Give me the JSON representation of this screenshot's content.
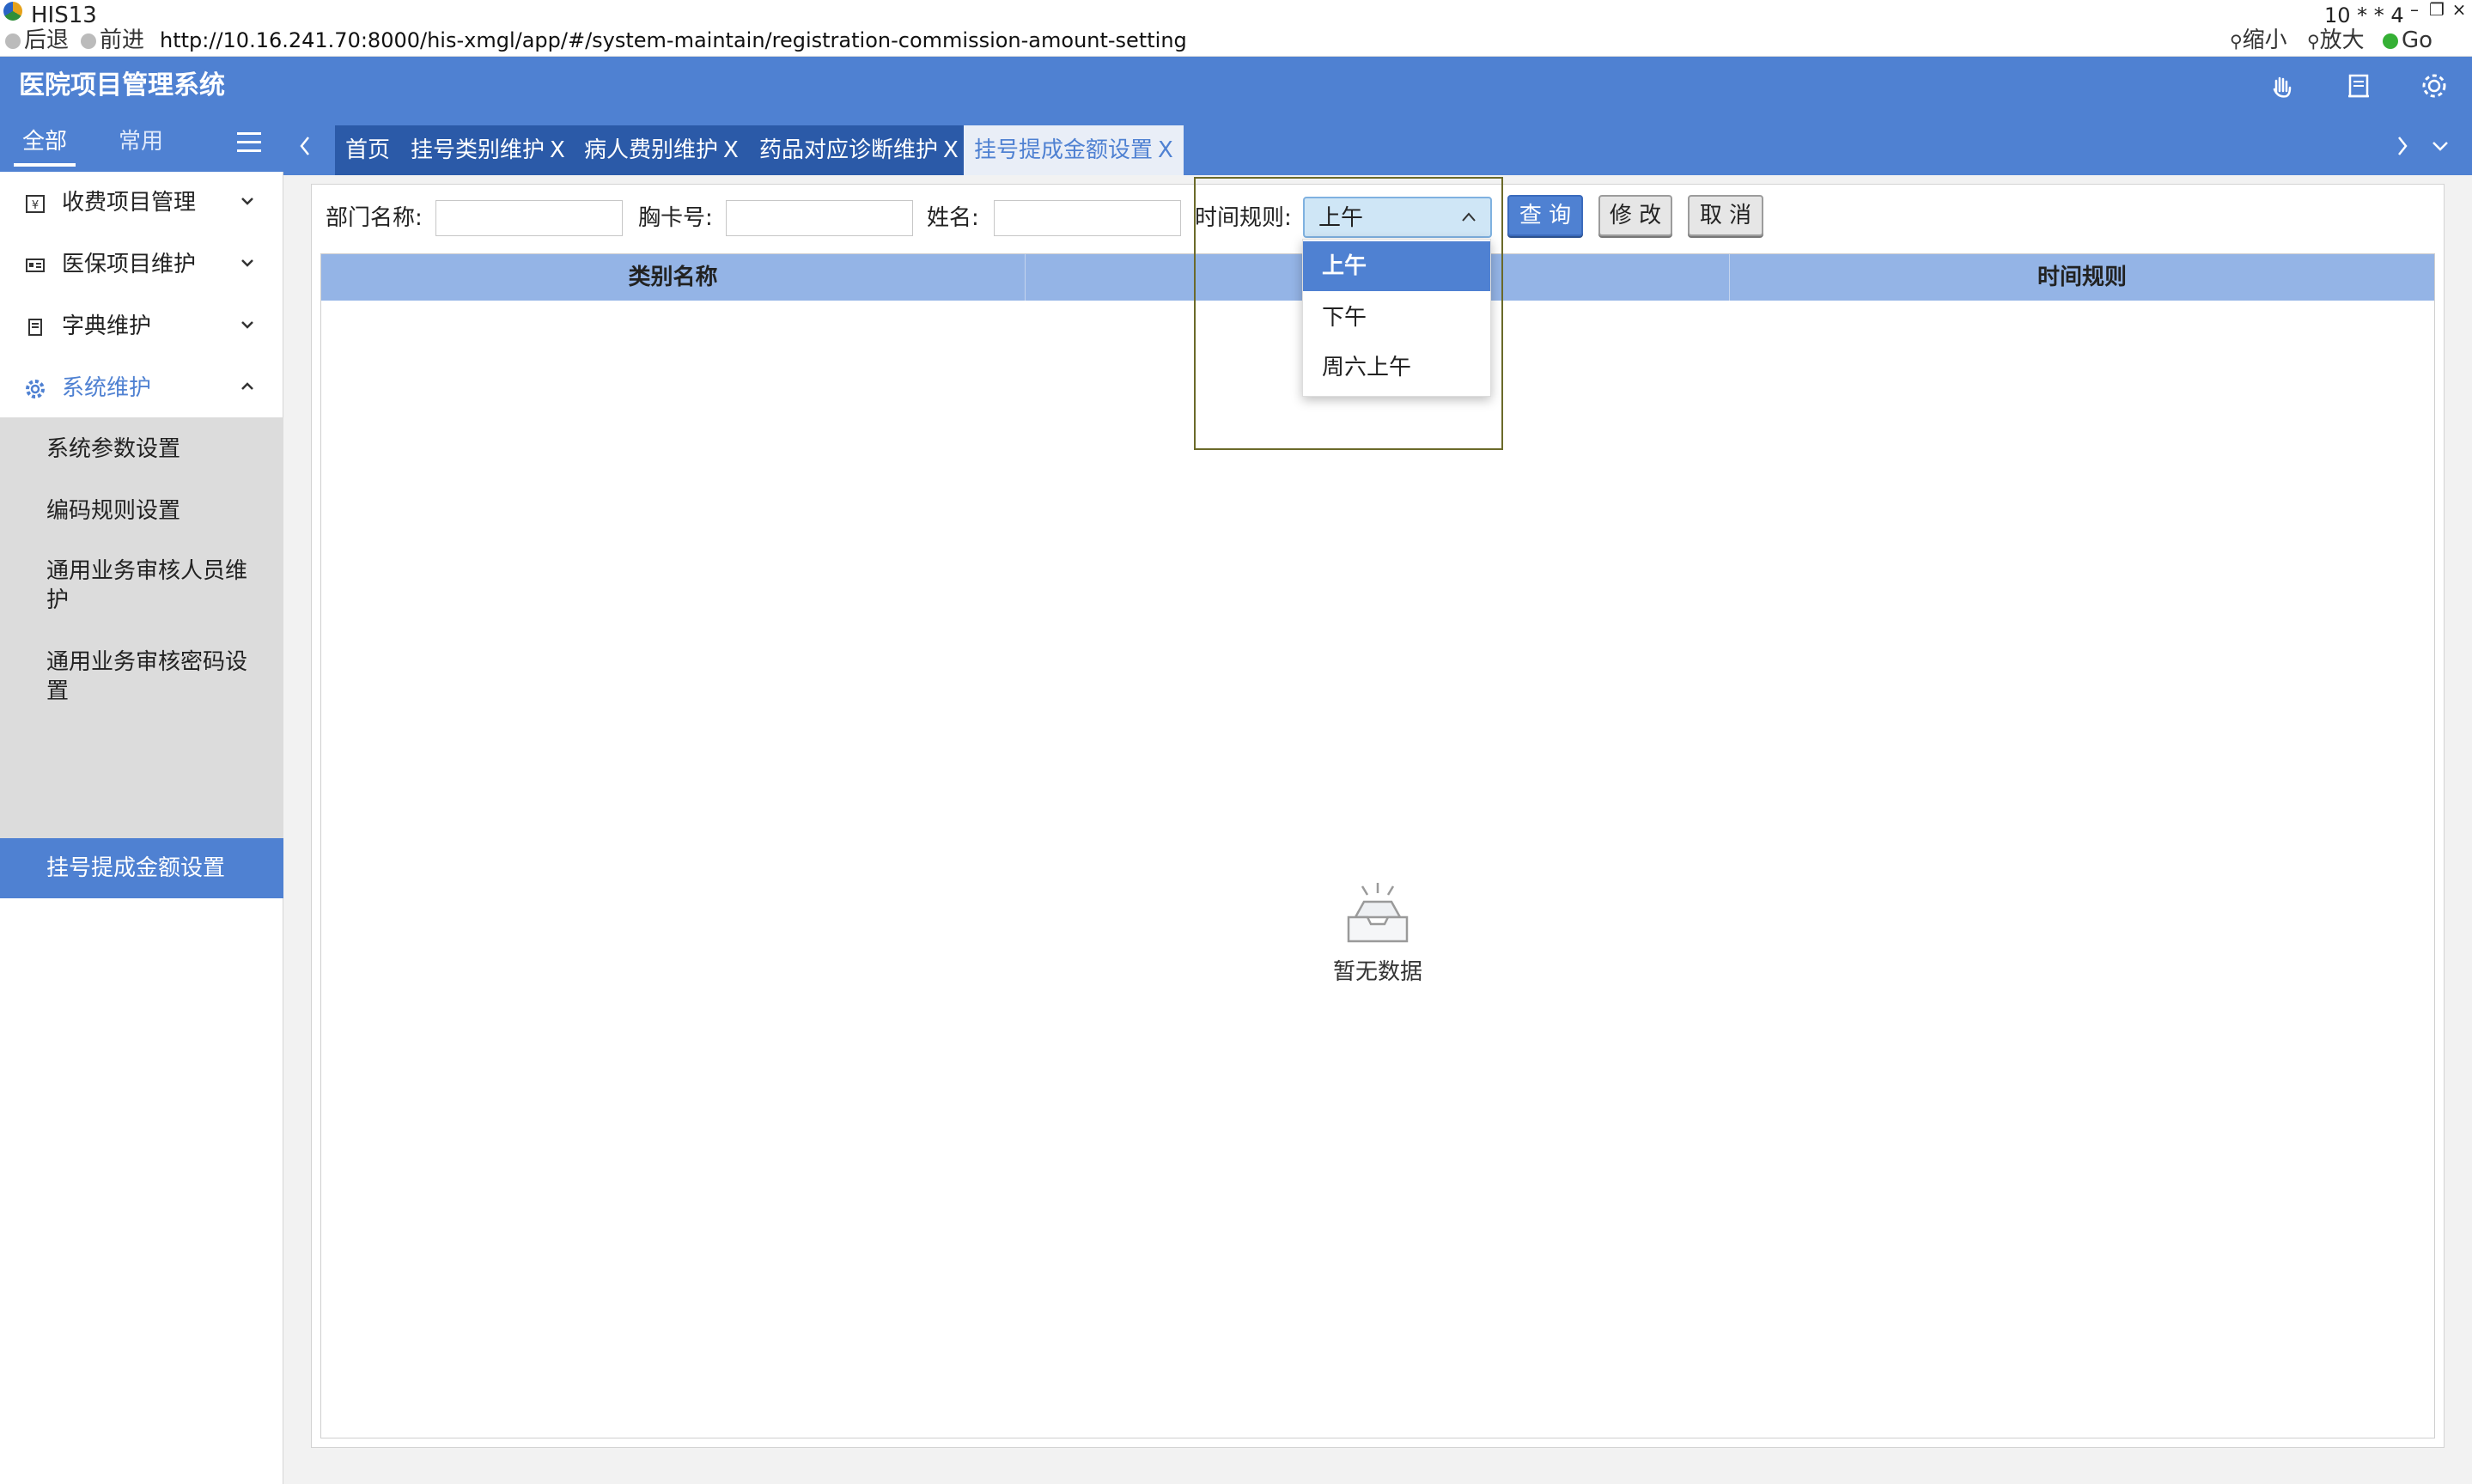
{
  "window": {
    "app_name": "HIS13",
    "right_text": "10 * * 4"
  },
  "nav": {
    "back": "后退",
    "forward": "前进",
    "url": "http://10.16.241.70:8000/his-xmgl/app/#/system-maintain/registration-commission-amount-setting",
    "zoom_out": "缩小",
    "zoom_in": "放大",
    "go": "Go"
  },
  "header": {
    "title": "医院项目管理系统"
  },
  "sidebar": {
    "tabs": [
      "全部",
      "常用"
    ],
    "menus": [
      {
        "label": "收费项目管理",
        "icon": "fee-icon",
        "expanded": false
      },
      {
        "label": "医保项目维护",
        "icon": "id-card-icon",
        "expanded": false
      },
      {
        "label": "字典维护",
        "icon": "book-icon",
        "expanded": false
      },
      {
        "label": "系统维护",
        "icon": "gear-icon",
        "expanded": true
      }
    ],
    "submenu": [
      "系统参数设置",
      "编码规则设置",
      "通用业务审核人员维护",
      "通用业务审核密码设置",
      "挂号提成金额设置"
    ]
  },
  "tabs": [
    {
      "label": "首页",
      "closable": false
    },
    {
      "label": "挂号类别维护",
      "closable": true
    },
    {
      "label": "病人费别维护",
      "closable": true
    },
    {
      "label": "药品对应诊断维护",
      "closable": true
    },
    {
      "label": "挂号提成金额设置",
      "closable": true,
      "active": true
    }
  ],
  "tab_close": "X",
  "filters": {
    "dept_label": "部门名称:",
    "card_label": "胸卡号:",
    "name_label": "姓名:",
    "time_label": "时间规则:",
    "time_value": "上午",
    "dept_value": "",
    "card_value": "",
    "name_value": ""
  },
  "buttons": {
    "query": "查 询",
    "edit": "修 改",
    "cancel": "取 消"
  },
  "grid": {
    "columns": [
      "类别名称",
      "",
      "时间规则"
    ],
    "empty_text": "暂无数据"
  },
  "dropdown": {
    "options": [
      "上午",
      "下午",
      "周六上午"
    ],
    "selected": "上午"
  },
  "colors": {
    "brand": "#4f81d2",
    "tab_dark": "#2b5aa8",
    "grid_header": "#94b4e6"
  }
}
